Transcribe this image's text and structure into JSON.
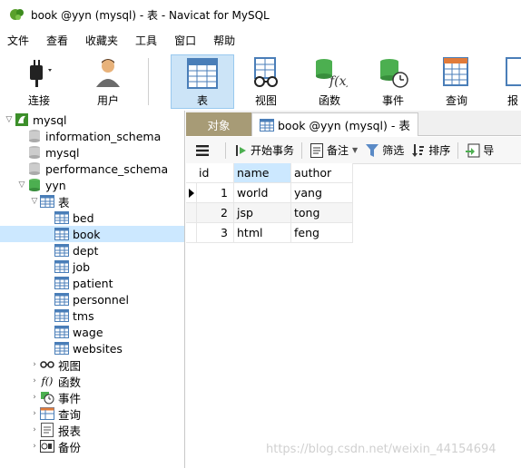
{
  "window": {
    "title": "book @yyn (mysql) - 表 - Navicat for MySQL"
  },
  "menu": [
    "文件",
    "查看",
    "收藏夹",
    "工具",
    "窗口",
    "帮助"
  ],
  "toolbar": {
    "connect": "连接",
    "user": "用户",
    "table": "表",
    "view": "视图",
    "function": "函数",
    "event": "事件",
    "query": "查询",
    "report": "报"
  },
  "tree": {
    "conn": "mysql",
    "db_information_schema": "information_schema",
    "db_mysql": "mysql",
    "db_performance_schema": "performance_schema",
    "db_yyn": "yyn",
    "tables_folder": "表",
    "tables": [
      "bed",
      "book",
      "dept",
      "job",
      "patient",
      "personnel",
      "tms",
      "wage",
      "websites"
    ],
    "views": "视图",
    "functions": "函数",
    "events": "事件",
    "queries": "查询",
    "reports": "报表",
    "backups": "备份"
  },
  "tabs": {
    "objects": "对象",
    "book": "book @yyn (mysql) - 表"
  },
  "grid_toolbar": {
    "begin_tx": "开始事务",
    "memo": "备注",
    "filter": "筛选",
    "sort": "排序",
    "import": "导"
  },
  "grid": {
    "columns": [
      "id",
      "name",
      "author"
    ],
    "rows": [
      [
        "1",
        "world",
        "yang"
      ],
      [
        "2",
        "jsp",
        "tong"
      ],
      [
        "3",
        "html",
        "feng"
      ]
    ]
  },
  "watermark": "https://blog.csdn.net/weixin_44154694"
}
